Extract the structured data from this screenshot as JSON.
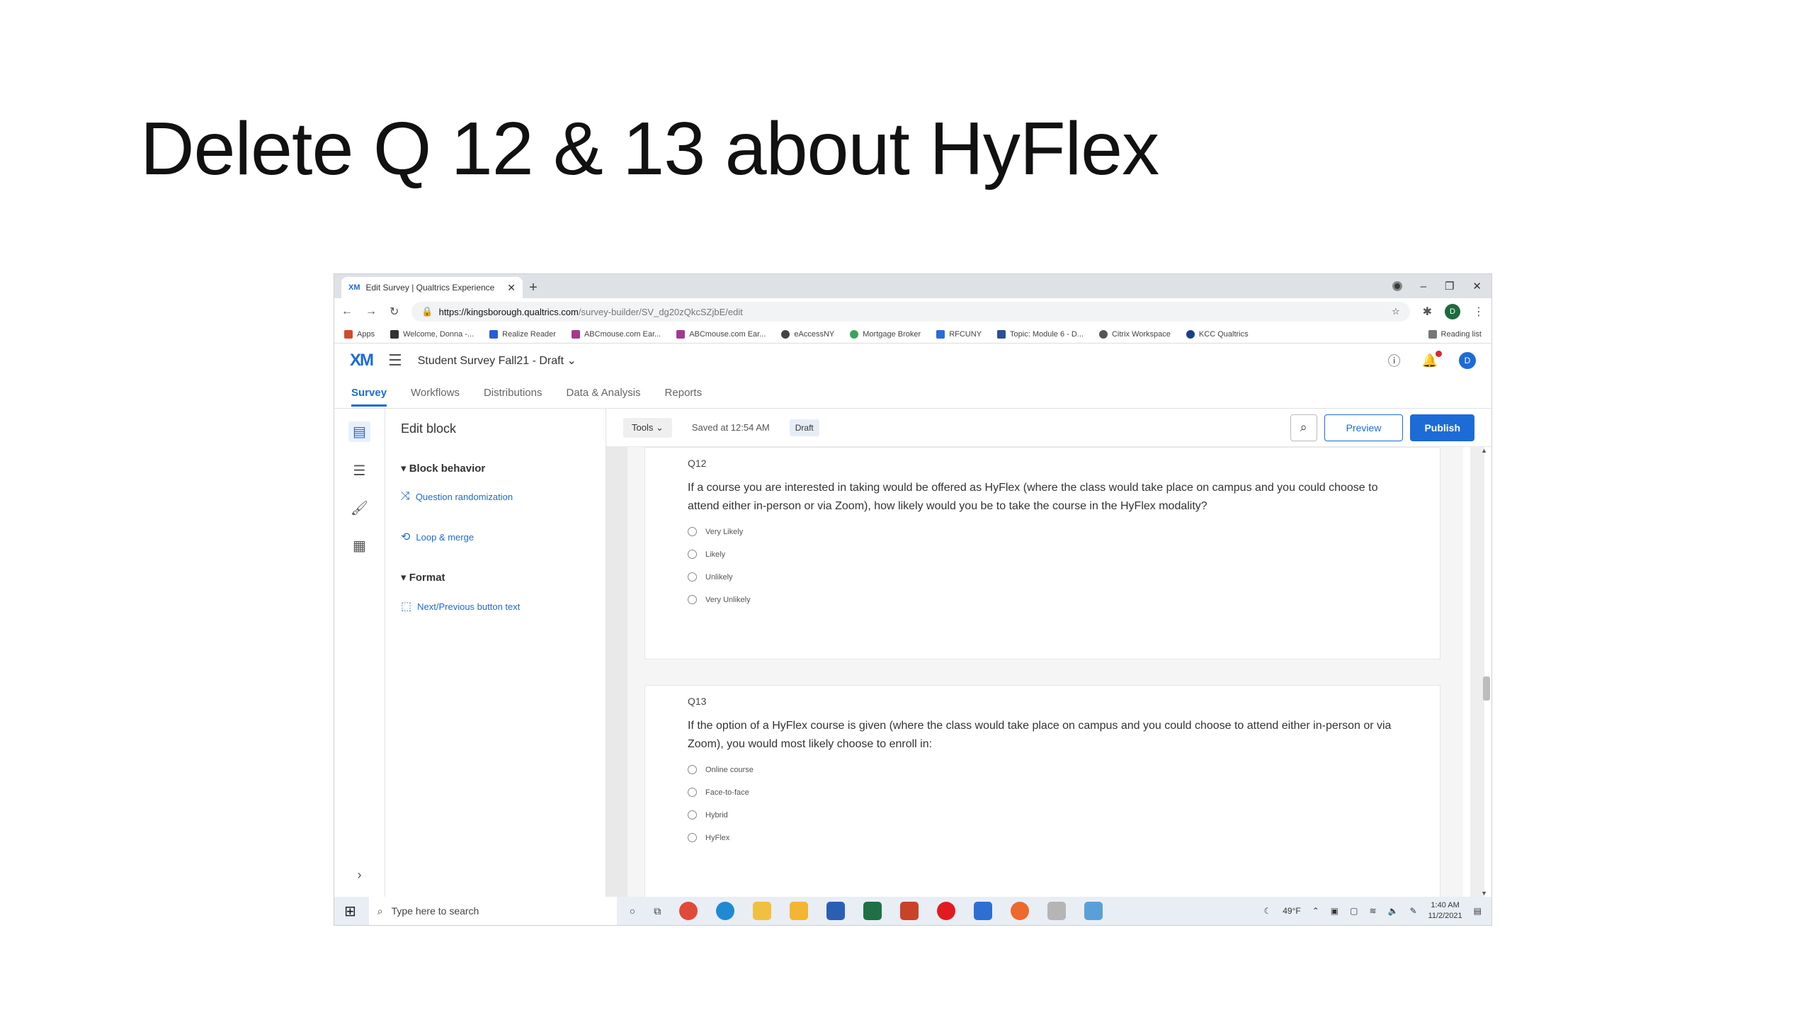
{
  "slide": {
    "title": "Delete Q 12 & 13 about HyFlex"
  },
  "browser": {
    "tab_title": "Edit Survey | Qualtrics Experience",
    "tab_favicon": "XM",
    "url_host": "https://kingsborough.qualtrics.com",
    "url_path": "/survey-builder/SV_dg20zQkcSZjbE/edit",
    "profile_initial": "D",
    "bookmarks": [
      "Apps",
      "Welcome, Donna -...",
      "Realize Reader",
      "ABCmouse.com Ear...",
      "ABCmouse.com Ear...",
      "eAccessNY",
      "Mortgage Broker",
      "RFCUNY",
      "Topic: Module 6 - D...",
      "Citrix Workspace",
      "KCC Qualtrics"
    ],
    "reading_list": "Reading list"
  },
  "qualtrics": {
    "logo": "XM",
    "survey_name": "Student Survey Fall21 - Draft",
    "avatar_initial": "D",
    "nav": [
      "Survey",
      "Workflows",
      "Distributions",
      "Data & Analysis",
      "Reports"
    ],
    "left_panel": {
      "heading": "Edit block",
      "block_behavior": "Block behavior",
      "question_randomization": "Question randomization",
      "loop_merge": "Loop & merge",
      "format": "Format",
      "next_prev_text": "Next/Previous button text"
    },
    "toolbar": {
      "tools": "Tools",
      "saved": "Saved at 12:54 AM",
      "draft": "Draft",
      "preview": "Preview",
      "publish": "Publish"
    },
    "questions": [
      {
        "number": "Q12",
        "text": "If a course you are interested in taking would be offered as HyFlex (where the class would take place on campus and you could choose to attend either in-person or via Zoom), how likely would you be to take the course in the HyFlex modality?",
        "choices": [
          "Very Likely",
          "Likely",
          "Unlikely",
          "Very Unlikely"
        ]
      },
      {
        "number": "Q13",
        "text": "If the option of a HyFlex course is given (where the class would take place on campus and you could choose to attend either in-person or via Zoom), you would most likely choose to enroll in:",
        "choices": [
          "Online course",
          "Face-to-face",
          "Hybrid",
          "HyFlex"
        ]
      }
    ]
  },
  "taskbar": {
    "search_placeholder": "Type here to search",
    "weather": "49°F",
    "time": "1:40 AM",
    "date": "11/2/2021"
  }
}
